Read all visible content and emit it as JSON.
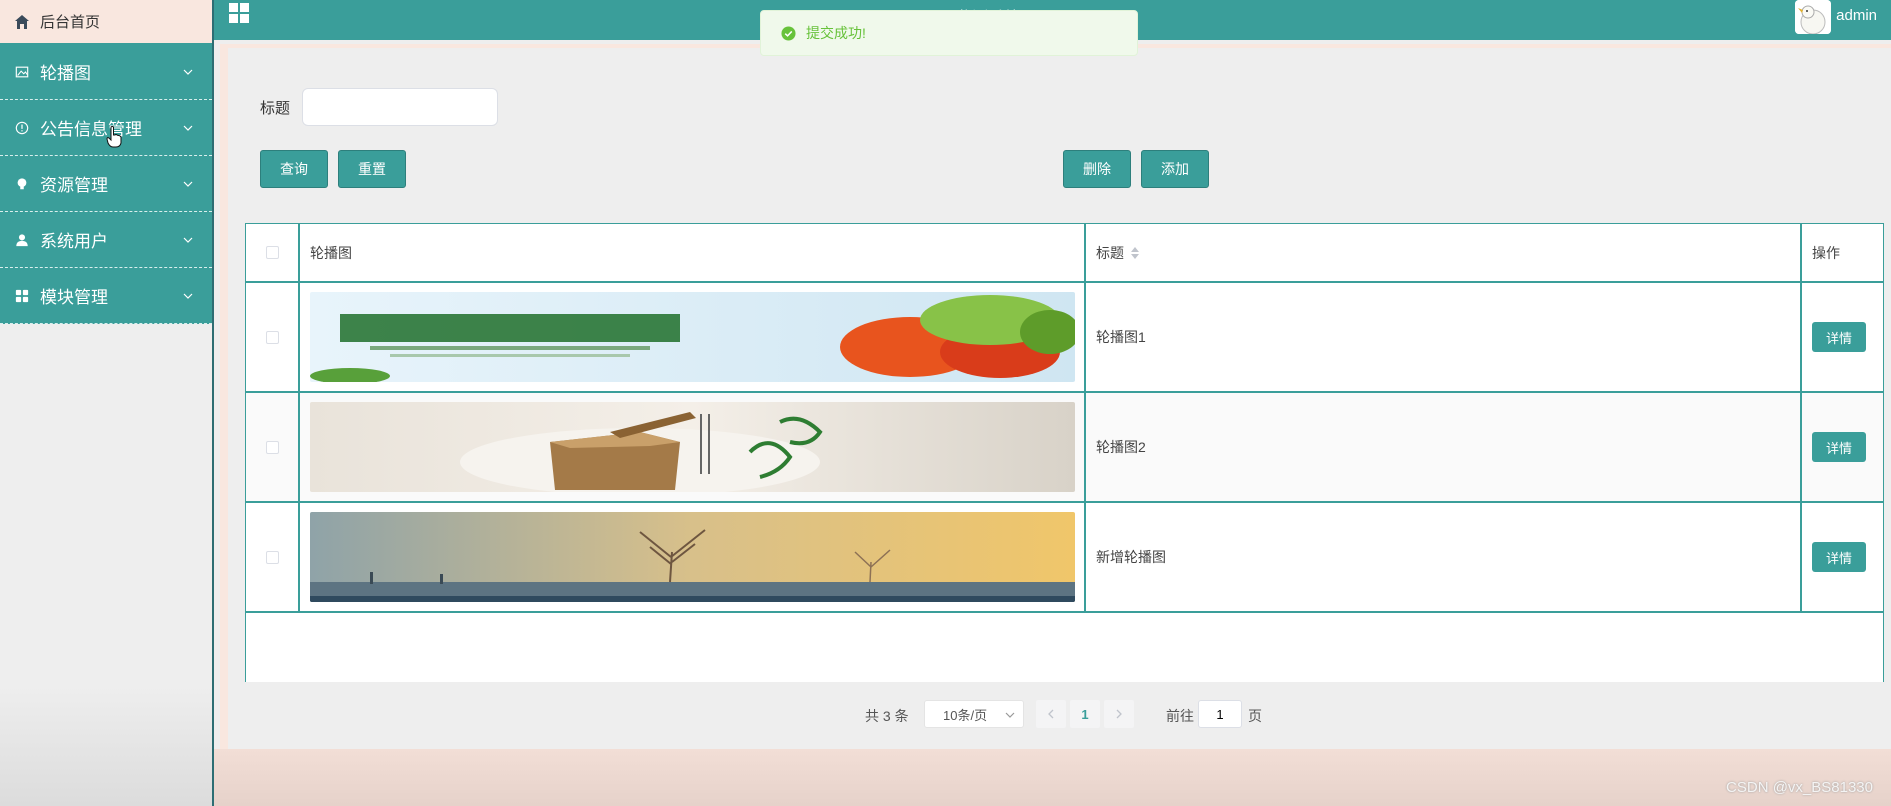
{
  "sidebar": {
    "home_label": "后台首页",
    "items": [
      {
        "label": "轮播图",
        "icon": "picture-icon"
      },
      {
        "label": "公告信息管理",
        "icon": "info-circle-icon"
      },
      {
        "label": "资源管理",
        "icon": "lightbulb-icon"
      },
      {
        "label": "系统用户",
        "icon": "user-icon"
      },
      {
        "label": "模块管理",
        "icon": "grid-icon"
      }
    ]
  },
  "header": {
    "title": "……监测系统",
    "username": "admin"
  },
  "toast": {
    "message": "提交成功!"
  },
  "search": {
    "title_label": "标题",
    "title_value": "",
    "query_button": "查询",
    "reset_button": "重置",
    "delete_button": "删除",
    "add_button": "添加"
  },
  "table": {
    "columns": [
      "轮播图",
      "标题",
      "操作"
    ],
    "rows": [
      {
        "title": "轮播图1",
        "action": "详情",
        "image": "vegetables-banner"
      },
      {
        "title": "轮播图2",
        "action": "详情",
        "image": "rice-sack-banner"
      },
      {
        "title": "新增轮播图",
        "action": "详情",
        "image": "sunset-tree-banner"
      }
    ]
  },
  "pagination": {
    "total": "共 3 条",
    "page_size": "10条/页",
    "current_page": "1",
    "goto_label": "前往",
    "goto_value": "1",
    "page_unit": "页"
  },
  "watermark": "CSDN @vx_BS81330",
  "colors": {
    "primary": "#3a9e9a",
    "home_bg": "#f9e7df",
    "success": "#67c23a"
  }
}
